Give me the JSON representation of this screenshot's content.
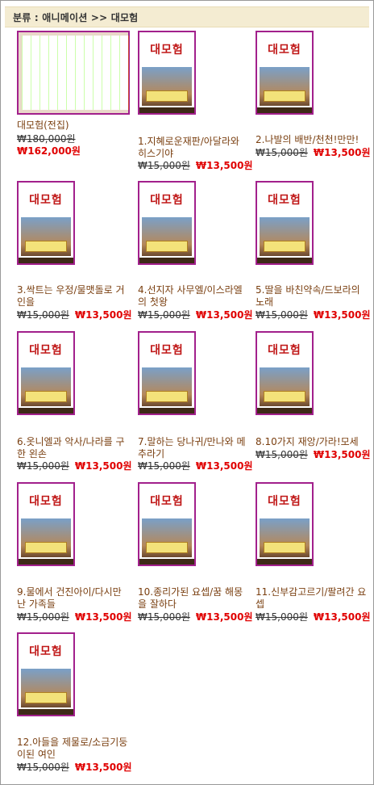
{
  "header": {
    "category_label": "분류 : 애니메이션 >> 대모험"
  },
  "colors": {
    "thumbnail_border": "#a2208c",
    "sale_price": "#e00000",
    "product_name": "#7a3f10"
  },
  "products": [
    {
      "name": "대모험(전집)",
      "old_price": "₩180,000원",
      "new_price": "₩162,000원"
    },
    {
      "name": "1.지혜로운재판/아달라와 히스기야",
      "old_price": "₩15,000원",
      "new_price": "₩13,500원"
    },
    {
      "name": "2.나발의 배반/천천!만만!",
      "old_price": "₩15,000원",
      "new_price": "₩13,500원"
    },
    {
      "name": "3.싹트는 우정/물맷돌로 거인을",
      "old_price": "₩15,000원",
      "new_price": "₩13,500원"
    },
    {
      "name": "4.선지자 사무엘/이스라엘의 첫왕",
      "old_price": "₩15,000원",
      "new_price": "₩13,500원"
    },
    {
      "name": "5.딸을 바친약속/드보라의 노래",
      "old_price": "₩15,000원",
      "new_price": "₩13,500원"
    },
    {
      "name": "6.옷니엘과 악사/나라를 구한 왼손",
      "old_price": "₩15,000원",
      "new_price": "₩13,500원"
    },
    {
      "name": "7.말하는 당나귀/만나와 메추라기",
      "old_price": "₩15,000원",
      "new_price": "₩13,500원"
    },
    {
      "name": "8.10가지 재앙/가라!모세",
      "old_price": "₩15,000원",
      "new_price": "₩13,500원"
    },
    {
      "name": "9.물에서 건진아이/다시만난 가족들",
      "old_price": "₩15,000원",
      "new_price": "₩13,500원"
    },
    {
      "name": "10.종리가된 요셉/꿈 해몽을 잘하다",
      "old_price": "₩15,000원",
      "new_price": "₩13,500원"
    },
    {
      "name": "11.신부감고르기/팔려간 요셉",
      "old_price": "₩15,000원",
      "new_price": "₩13,500원"
    },
    {
      "name": "12.아들을 제물로/소금기둥이된 여인",
      "old_price": "₩15,000원",
      "new_price": "₩13,500원"
    }
  ],
  "cover_brand": "대모험"
}
